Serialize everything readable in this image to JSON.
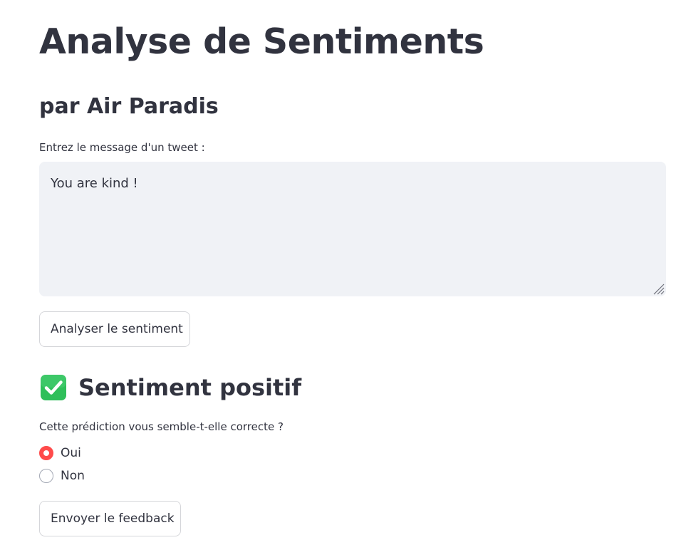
{
  "app": {
    "title": "Analyse de Sentiments",
    "subtitle": "par Air Paradis"
  },
  "input": {
    "label": "Entrez le message d'un tweet :",
    "value": "You are kind !"
  },
  "analyze_button": {
    "label": "Analyser le sentiment"
  },
  "result": {
    "icon": "check-mark-button-icon",
    "icon_color": "#2fbf5a",
    "text": "Sentiment positif"
  },
  "feedback": {
    "question": "Cette prédiction vous semble-t-elle correcte ?",
    "options": [
      {
        "label": "Oui",
        "selected": true
      },
      {
        "label": "Non",
        "selected": false
      }
    ],
    "accent_color": "#ff4b4b",
    "submit_label": "Envoyer le feedback"
  }
}
